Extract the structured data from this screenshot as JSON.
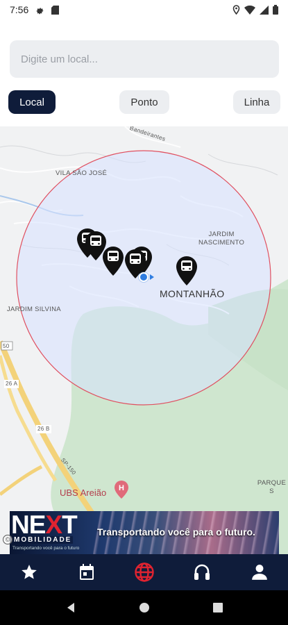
{
  "status_bar": {
    "time": "7:56",
    "icons_left": [
      "gear-icon",
      "sd-card-icon"
    ],
    "icons_right": [
      "location-icon",
      "wifi-icon",
      "signal-icon",
      "battery-icon"
    ]
  },
  "search": {
    "placeholder": "Digite um local...",
    "value": ""
  },
  "filters": {
    "tabs": [
      {
        "label": "Local",
        "selected": true
      },
      {
        "label": "Ponto",
        "selected": false
      },
      {
        "label": "Linha",
        "selected": false
      }
    ]
  },
  "map": {
    "labels": {
      "vila_sao_jose": "VILA SÃO JOSÉ",
      "jardim_nascimento": "JARDIM\nNASCIMENTO",
      "montanhao": "MONTANHÃO",
      "jardim_silvina": "JARDIM SILVINA",
      "parque": "PARQUE S",
      "road_50": "50",
      "road_26a": "26 A",
      "road_26b": "26 B",
      "road_sp150": "SP-150",
      "street_top": "Bandeirantes",
      "ubs": "UBS Areião"
    },
    "search_radius_color": "#e05060",
    "bus_marker_count": 6
  },
  "banner": {
    "logo_prefix": "NE",
    "logo_x": "X",
    "logo_suffix": "T",
    "logo_sub": "MOBILIDADE",
    "tagline_small": "Transportando você para o futuro",
    "slogan": "Transportando você para o futuro."
  },
  "bottom_nav": {
    "items": [
      {
        "icon": "star-icon",
        "active": false
      },
      {
        "icon": "calendar-icon",
        "active": false
      },
      {
        "icon": "globe-icon",
        "active": true
      },
      {
        "icon": "headset-icon",
        "active": false
      },
      {
        "icon": "user-icon",
        "active": false
      }
    ],
    "active_color": "#e02330",
    "inactive_color": "#ffffff"
  },
  "colors": {
    "primary": "#0f1c3a",
    "accent": "#e02330",
    "tab_bg": "#eceef1"
  }
}
